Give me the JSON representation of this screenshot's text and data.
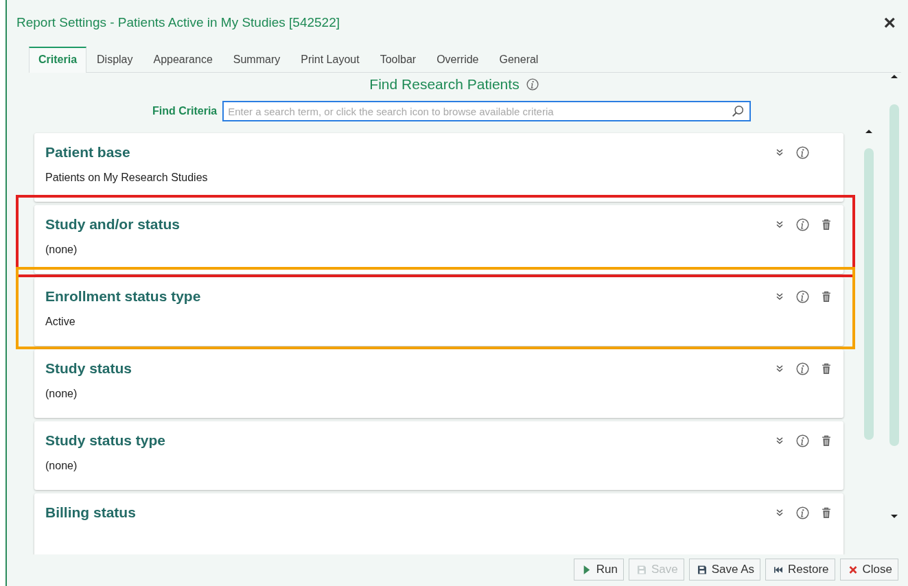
{
  "window": {
    "title": "Report Settings - Patients Active in My Studies [542522]",
    "close": "×"
  },
  "tabs": [
    {
      "label": "Criteria",
      "selected": true
    },
    {
      "label": "Display",
      "selected": false
    },
    {
      "label": "Appearance",
      "selected": false
    },
    {
      "label": "Summary",
      "selected": false
    },
    {
      "label": "Print Layout",
      "selected": false
    },
    {
      "label": "Toolbar",
      "selected": false
    },
    {
      "label": "Override",
      "selected": false
    },
    {
      "label": "General",
      "selected": false
    }
  ],
  "heading": "Find Research Patients",
  "find": {
    "label": "Find Criteria",
    "placeholder": "Enter a search term, or click the search icon to browse available criteria"
  },
  "cards": [
    {
      "title": "Patient base",
      "value": "Patients on My Research Studies",
      "deletable": false
    },
    {
      "title": "Study and/or status",
      "value": "(none)",
      "deletable": true,
      "color": "#e3201f"
    },
    {
      "title": "Enrollment status type",
      "value": "Active",
      "deletable": true,
      "color": "#f5a300"
    },
    {
      "title": "Study status",
      "value": "(none)",
      "deletable": true
    },
    {
      "title": "Study status type",
      "value": "(none)",
      "deletable": true
    },
    {
      "title": "Billing status",
      "deletable": true
    }
  ],
  "buttons": [
    {
      "label": "Run",
      "kind": "run",
      "disabled": false
    },
    {
      "label": "Save",
      "kind": "save",
      "disabled": true
    },
    {
      "label": "Save As",
      "kind": "saveas",
      "disabled": false
    },
    {
      "label": "Restore",
      "kind": "restore",
      "disabled": false
    },
    {
      "label": "Close",
      "kind": "close",
      "disabled": false
    }
  ]
}
